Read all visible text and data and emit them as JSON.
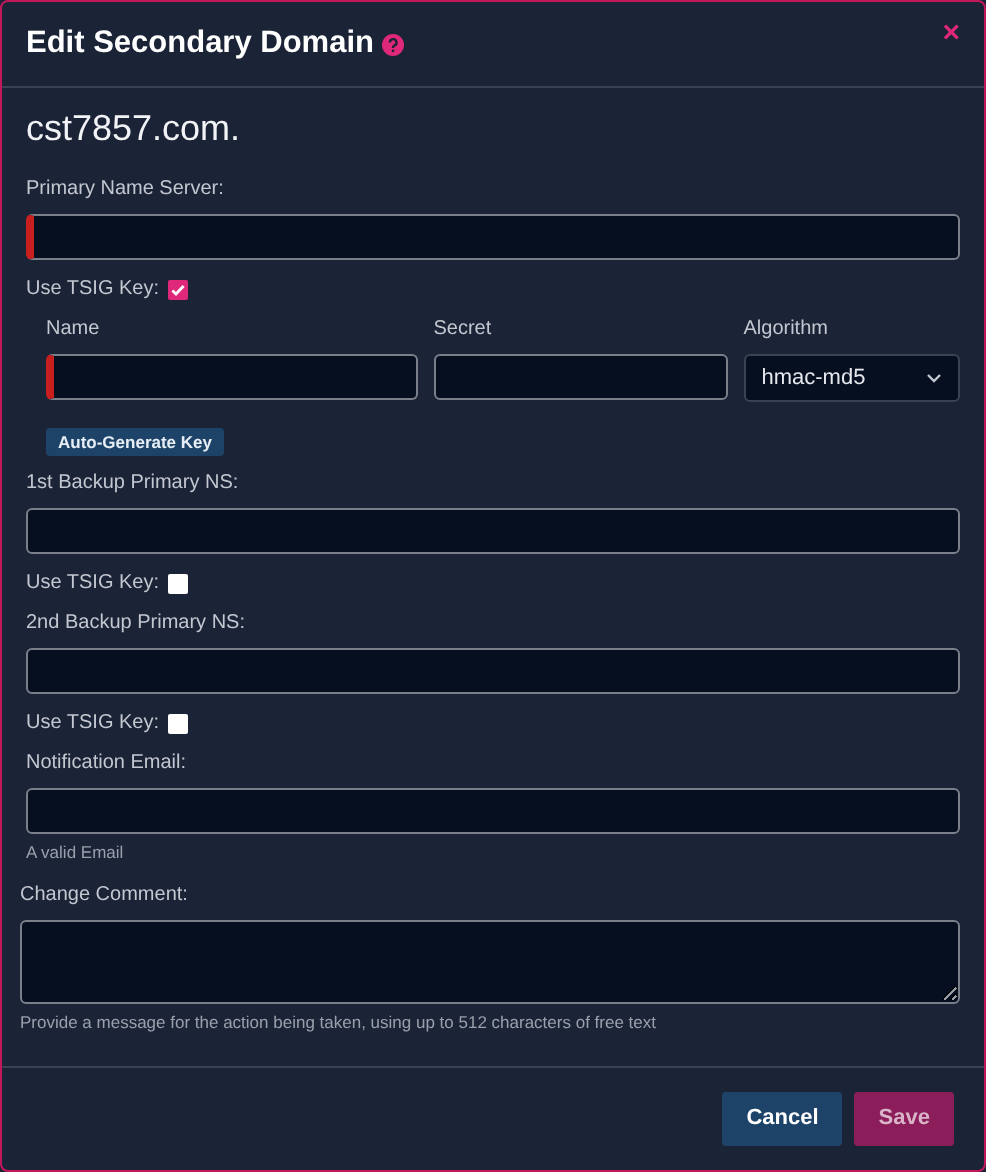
{
  "title": "Edit Secondary Domain",
  "close": "×",
  "domain": "cst7857.com.",
  "primary_ns": {
    "label": "Primary Name Server:",
    "invalid": true
  },
  "items": [
    {
      "kind": "checkbox",
      "label": "Use TSIG Key:",
      "checked": true
    },
    {
      "kind": "tsig",
      "name": {
        "label": "Name",
        "invalid": true
      },
      "secret": {
        "label": "Secret",
        "invalid": false
      },
      "algorithm": {
        "label": "Algorithm",
        "value": "hmac-md5"
      },
      "generate": "Auto-Generate Key"
    },
    {
      "kind": "field",
      "label": "1st Backup Primary NS:",
      "invalid": false
    },
    {
      "kind": "checkbox",
      "label": "Use TSIG Key:",
      "checked": false
    },
    {
      "kind": "field",
      "label": "2nd Backup Primary NS:",
      "invalid": false
    },
    {
      "kind": "checkbox",
      "label": "Use TSIG Key:",
      "checked": false
    },
    {
      "kind": "field",
      "label": "Notification Email:",
      "invalid": false,
      "help": "A valid Email"
    }
  ],
  "comment": {
    "label": "Change Comment:",
    "help": "Provide a message for the action being taken, using up to 512 characters of free text"
  },
  "buttons": [
    {
      "label": "Cancel",
      "kind": "cancel",
      "disabled": false
    },
    {
      "label": "Save",
      "kind": "save",
      "disabled": true
    }
  ]
}
